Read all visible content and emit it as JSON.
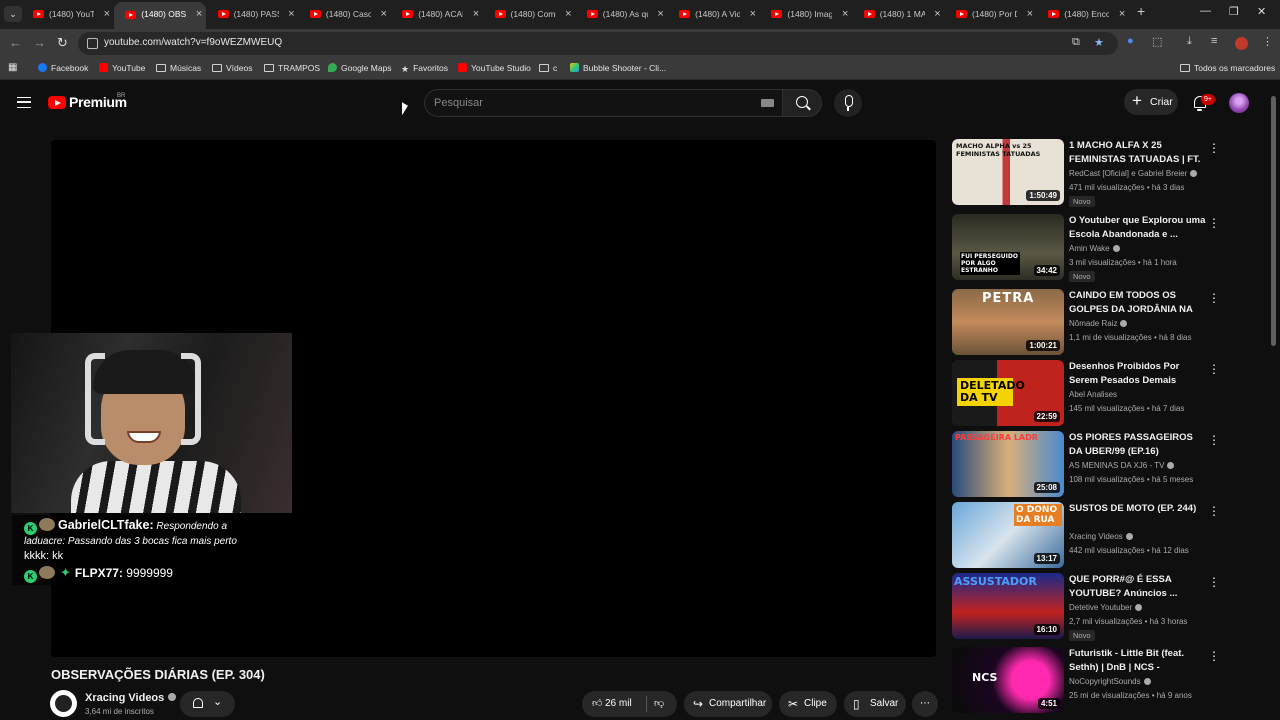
{
  "browser": {
    "tabs": [
      {
        "title": "(1480) YouTu",
        "active": false
      },
      {
        "title": "(1480) OBSE",
        "active": true
      },
      {
        "title": "(1480) PASS",
        "active": false
      },
      {
        "title": "(1480) Caso",
        "active": false
      },
      {
        "title": "(1480) ACAM",
        "active": false
      },
      {
        "title": "(1480) Comp",
        "active": false
      },
      {
        "title": "(1480) As qu",
        "active": false
      },
      {
        "title": "(1480) A Vid",
        "active": false
      },
      {
        "title": "(1480) Imag",
        "active": false
      },
      {
        "title": "(1480) 1 MA",
        "active": false
      },
      {
        "title": "(1480) Por D",
        "active": false
      },
      {
        "title": "(1480) Enco",
        "active": false
      }
    ],
    "url": "youtube.com/watch?v=f9oWEZMWEUQ",
    "bookmarks": [
      {
        "label": "Facebook",
        "icon": "facebook-icon"
      },
      {
        "label": "YouTube",
        "icon": "youtube-icon"
      },
      {
        "label": "Músicas",
        "icon": "folder-icon"
      },
      {
        "label": "Vídeos",
        "icon": "folder-icon"
      },
      {
        "label": "TRAMPOS",
        "icon": "folder-icon"
      },
      {
        "label": "Google Maps",
        "icon": "maps-icon"
      },
      {
        "label": "Favoritos",
        "icon": "star-icon"
      },
      {
        "label": "YouTube Studio",
        "icon": "youtube-icon"
      },
      {
        "label": "c",
        "icon": "folder-icon"
      },
      {
        "label": "Bubble Shooter - Cli...",
        "icon": "bubble-icon"
      }
    ],
    "all_bookmarks": "Todos os marcadores"
  },
  "header": {
    "logo": "Premium",
    "country": "BR",
    "search_placeholder": "Pesquisar",
    "create_label": "Criar",
    "notif_count": "9+"
  },
  "overlay": {
    "chat": [
      {
        "user": "GabrielCLTfake:",
        "message": "Respondendo a laduacre: Passando das 3 bocas fica mais perto",
        "extra": "kkkk: kk"
      },
      {
        "user": "FLPX77:",
        "message": "9999999"
      }
    ]
  },
  "video": {
    "title": "OBSERVAÇÕES DIÁRIAS (EP. 304)",
    "channel": "Xracing Videos",
    "subscribers": "3,64 mi de inscritos",
    "likes": "26 mil",
    "share_label": "Compartilhar",
    "clip_label": "Clipe",
    "save_label": "Salvar"
  },
  "recommendations": [
    {
      "title": "1 MACHO ALFA X 25 FEMINISTAS TATUADAS | FT. ...",
      "channel": "RedCast [Oficial] e Gabriel Breier",
      "verified": true,
      "views": "471 mil visualizações",
      "age": "há 3 dias",
      "duration": "1:50:49",
      "novo": "Novo",
      "thumb_text": "MACHO ALPHA vs 25 FEMINISTAS TATUADAS"
    },
    {
      "title": "O Youtuber que Explorou uma Escola Abandonada e ...",
      "channel": "Amin Wake",
      "verified": true,
      "views": "3 mil visualizações",
      "age": "há 1 hora",
      "duration": "34:42",
      "novo": "Novo",
      "thumb_text": "FUI PERSEGUIDO POR ALGO ESTRANHO"
    },
    {
      "title": "CAINDO EM TODOS OS GOLPES DA JORDÂNIA NA PRÁTICA JO",
      "channel": "Nômade Raiz",
      "verified": true,
      "views": "1,1 mi de visualizações",
      "age": "há 8 dias",
      "duration": "1:00:21",
      "novo": "",
      "thumb_text": "PETRA"
    },
    {
      "title": "Desenhos Proibidos Por Serem Pesados Demais",
      "channel": "Abel Analises",
      "verified": false,
      "views": "145 mil visualizações",
      "age": "há 7 dias",
      "duration": "22:59",
      "novo": "",
      "thumb_text": "DELETADO DA TV"
    },
    {
      "title": "OS PIORES PASSAGEIROS DA UBER/99 (EP.16)",
      "channel": "AS MENINAS DA XJ6 - TV",
      "verified": true,
      "views": "108 mil visualizações",
      "age": "há 5 meses",
      "duration": "25:08",
      "novo": "",
      "thumb_text": "PASSAGEIRA LADR"
    },
    {
      "title": "SUSTOS DE MOTO (EP. 244)",
      "channel": "Xracing Videos",
      "verified": true,
      "views": "442 mil visualizações",
      "age": "há 12 dias",
      "duration": "13:17",
      "novo": "",
      "thumb_text": "O DONO DA RUA"
    },
    {
      "title": "QUE PORR#@ É ESSA YOUTUBE? Anúncios ...",
      "channel": "Detetive Youtuber",
      "verified": true,
      "views": "2,7 mil visualizações",
      "age": "há 3 horas",
      "duration": "16:10",
      "novo": "Novo",
      "thumb_text": "ASSUSTADOR"
    },
    {
      "title": "Futuristik - Little Bit (feat. Sethh) | DnB | NCS - Copyright ...",
      "channel": "NoCopyrightSounds",
      "verified": true,
      "views": "25 mi de visualizações",
      "age": "há 9 anos",
      "duration": "4:51",
      "novo": "",
      "thumb_text": "NCS"
    }
  ]
}
